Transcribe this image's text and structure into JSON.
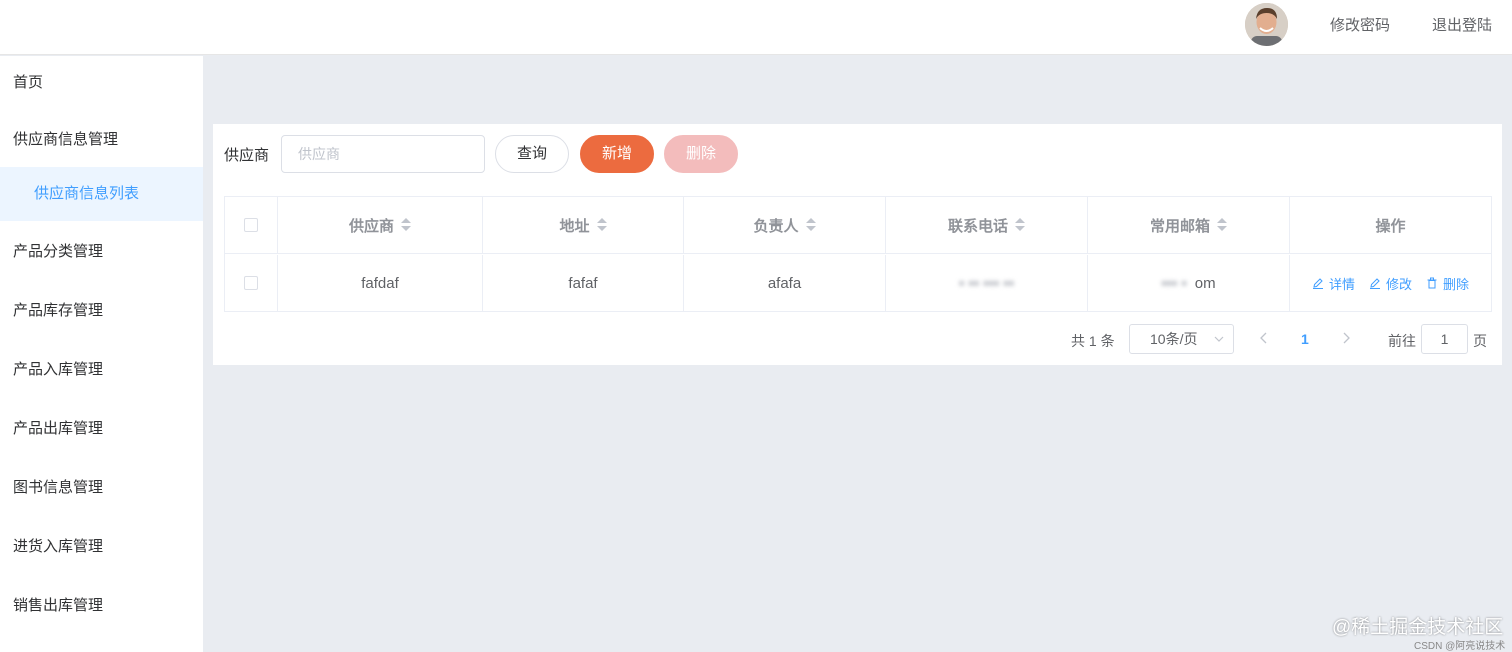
{
  "header": {
    "avatar_alt": "",
    "change_password": "修改密码",
    "logout": "退出登陆"
  },
  "sidebar": {
    "items": [
      {
        "label": "首页"
      },
      {
        "label": "供应商信息管理"
      },
      {
        "label": "供应商信息列表",
        "active": true
      },
      {
        "label": "产品分类管理"
      },
      {
        "label": "产品库存管理"
      },
      {
        "label": "产品入库管理"
      },
      {
        "label": "产品出库管理"
      },
      {
        "label": "图书信息管理"
      },
      {
        "label": "进货入库管理"
      },
      {
        "label": "销售出库管理"
      }
    ]
  },
  "search": {
    "label": "供应商",
    "placeholder": "供应商",
    "value": ""
  },
  "toolbar": {
    "query": "查询",
    "add": "新增",
    "delete": "删除"
  },
  "table": {
    "columns": [
      "供应商",
      "地址",
      "负责人",
      "联系电话",
      "常用邮箱",
      "操作"
    ],
    "rows": [
      {
        "supplier": "fafdaf",
        "address": "fafaf",
        "manager": "afafa",
        "phone": "",
        "email_visible": "om"
      }
    ],
    "row_actions": {
      "detail": "详情",
      "edit": "修改",
      "delete": "删除"
    }
  },
  "pagination": {
    "total": "共 1 条",
    "page_size": "10条/页",
    "current_page": "1",
    "goto_label": "前往",
    "goto_value": "1",
    "page_unit": "页"
  },
  "watermark": {
    "main": "@稀土掘金技术社区",
    "sub": "CSDN @阿亮说技术"
  },
  "colors": {
    "primary": "#409eff",
    "add_button": "#ec6b3f",
    "delete_button_disabled": "#f3bcbc",
    "background": "#e9ecf1"
  }
}
